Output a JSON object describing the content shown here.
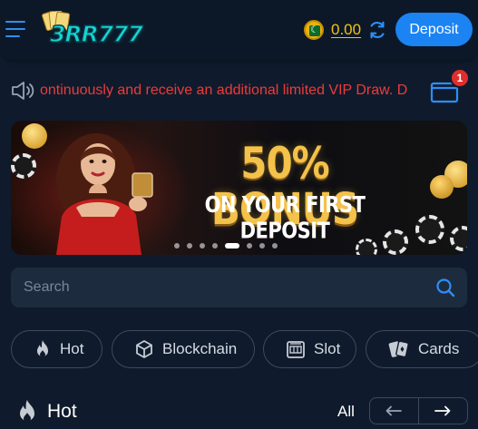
{
  "header": {
    "brand": "3RR777",
    "balance": "0.00",
    "deposit_label": "Deposit"
  },
  "announcement": {
    "text": "ontinuously and receive an additional limited VIP Draw. D"
  },
  "mail": {
    "badge_count": "1"
  },
  "banner": {
    "headline": "50% BONUS",
    "subline": "ON YOUR FIRST DEPOSIT",
    "slide_count": 8,
    "active_slide": 4
  },
  "search": {
    "placeholder": "Search"
  },
  "categories": [
    {
      "label": "Hot",
      "icon": "fire-icon"
    },
    {
      "label": "Blockchain",
      "icon": "cube-icon"
    },
    {
      "label": "Slot",
      "icon": "slot-machine-icon"
    },
    {
      "label": "Cards",
      "icon": "playing-cards-icon"
    }
  ],
  "section": {
    "title": "Hot",
    "all_label": "All"
  },
  "colors": {
    "accent": "#1b83f2",
    "balance": "#f2c018",
    "marquee": "#ec3b3b",
    "background": "#0f1b2c"
  }
}
